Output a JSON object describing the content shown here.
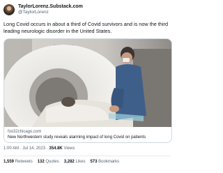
{
  "author": {
    "display_name": "TaylorLorenz.Substack.com",
    "handle": "@TaylorLorenz"
  },
  "tweet_text": "Long Covid occurs in about a third of Covid survivors and is now the third leading neurologic disorder in the United States.",
  "link_card": {
    "domain": "fox32chicago.com",
    "title": "New Northwestern study reveals alarming impact of long Covid on patients",
    "image_icon": "mri-scanner-photo"
  },
  "meta": {
    "time": "1:00 AM",
    "date": "Jul 14, 2023",
    "views": "354.8K",
    "views_label": "Views"
  },
  "stats": {
    "retweets": "1,559",
    "retweets_label": "Retweets",
    "quotes": "132",
    "quotes_label": "Quotes",
    "likes": "3,282",
    "likes_label": "Likes",
    "bookmarks": "573",
    "bookmarks_label": "Bookmarks"
  },
  "colors": {
    "text": "#0f1419",
    "secondary": "#536471",
    "border": "#cfd9de"
  }
}
